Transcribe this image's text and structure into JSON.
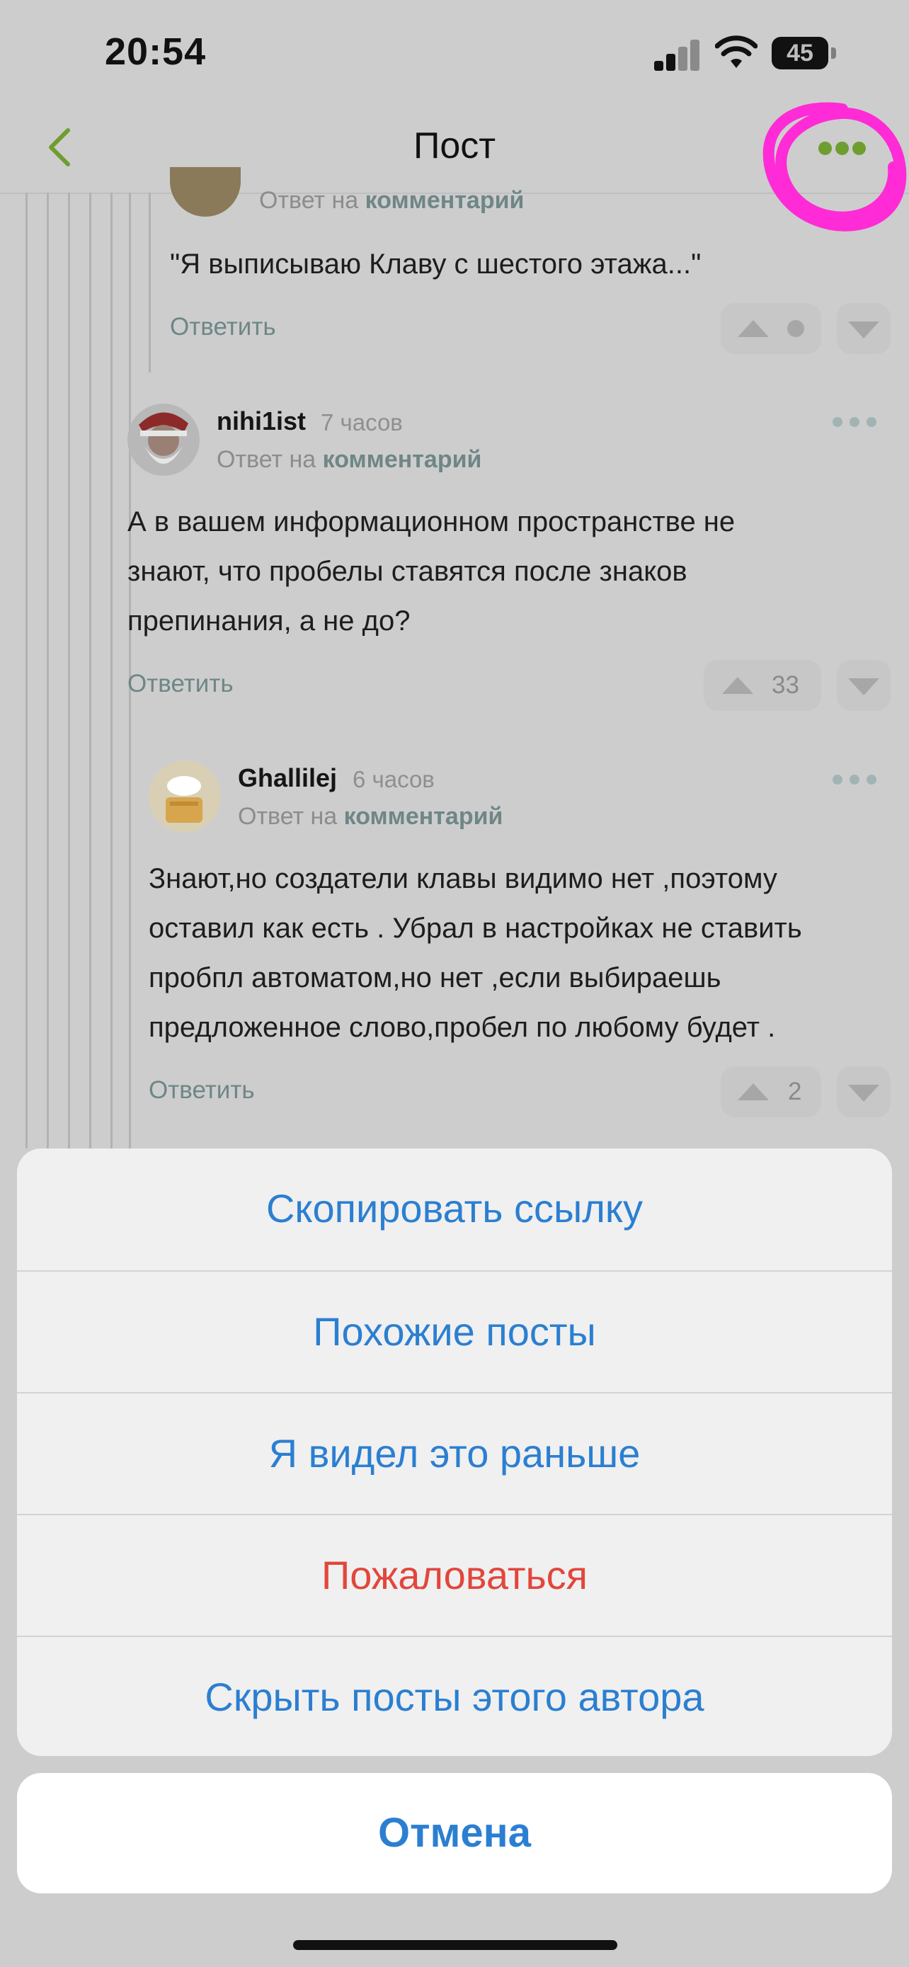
{
  "status_bar": {
    "time": "20:54",
    "battery": "45"
  },
  "nav": {
    "title": "Пост"
  },
  "comments": [
    {
      "reply_label": "Ответ на",
      "reply_target": "комментарий",
      "text": "\"Я выписываю Клаву с шестого этажа...\"",
      "reply_button": "Ответить"
    },
    {
      "username": "nihi1ist",
      "time": "7 часов",
      "reply_label": "Ответ на",
      "reply_target": "комментарий",
      "text_lines": [
        "А в вашем информационном пространстве не",
        "знают, что пробелы ставятся после знаков",
        "препинания, а не до?"
      ],
      "reply_button": "Ответить",
      "rating": "33"
    },
    {
      "username": "Ghallilej",
      "time": "6 часов",
      "reply_label": "Ответ на",
      "reply_target": "комментарий",
      "text_lines": [
        "Знают,но создатели клавы видимо нет ,поэтому",
        "оставил как есть . Убрал в настройках не ставить",
        "пробпл автоматом,но нет ,если выбираешь",
        "предложенное слово,пробел по любому будет ."
      ],
      "reply_button": "Ответить",
      "rating": "2"
    }
  ],
  "action_sheet": {
    "items": [
      "Скопировать ссылку",
      "Похожие посты",
      "Я видел это раньше",
      "Пожаловаться",
      "Скрыть посты этого автора"
    ],
    "cancel": "Отмена"
  },
  "colors": {
    "accent_green": "#6e9e2f",
    "sheet_blue": "#2b7fd1",
    "sheet_red": "#e2463c",
    "annotation_magenta": "#ff2bd6"
  }
}
